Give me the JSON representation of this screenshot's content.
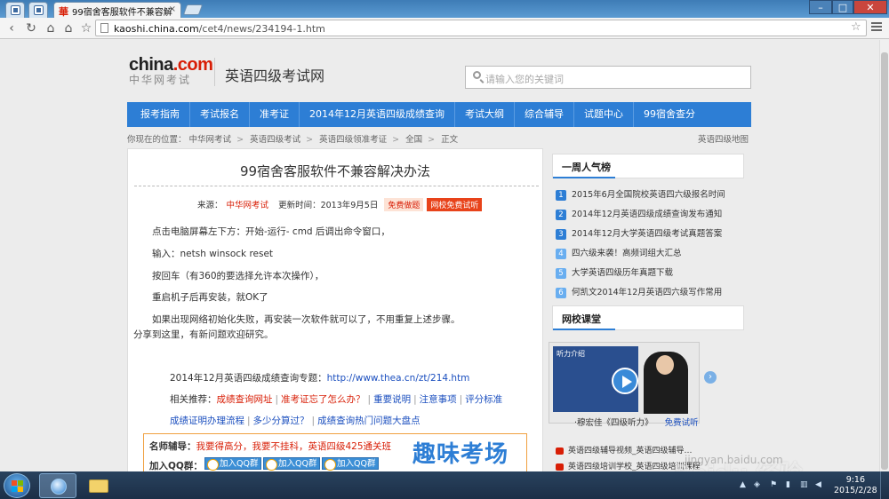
{
  "browser": {
    "tab_active_title": "99宿舍客服软件不兼容解",
    "tab_close": "×",
    "url_host": "kaoshi.china.com",
    "url_path": "/cet4/news/234194-1.htm",
    "win_minimize": "–",
    "win_maximize": "□",
    "win_close": "✕"
  },
  "header": {
    "logo_main": "china",
    "logo_dot": ".com",
    "logo_sub": "中华网考试",
    "site_title": "英语四级考试网",
    "search_placeholder": "请输入您的关键词"
  },
  "nav": [
    "报考指南",
    "考试报名",
    "准考证",
    "2014年12月英语四级成绩查询",
    "考试大纲",
    "综合辅导",
    "试题中心",
    "99宿舍查分"
  ],
  "breadcrumb": {
    "prefix": "你现在的位置：",
    "items": [
      "中华网考试",
      "英语四级考试",
      "英语四级领准考证",
      "全国",
      "正文"
    ],
    "sep": ">",
    "sitemap": "英语四级地图"
  },
  "article": {
    "title": "99宿舍客服软件不兼容解决办法",
    "source_label": "来源：",
    "source": "中华网考试",
    "updated_label": "更新时间：",
    "updated": "2013年9月5日",
    "tag1": "免费做题",
    "tag2": "网校免费试听",
    "paragraphs": [
      "点击电脑屏幕左下方：开始-运行- cmd 后调出命令窗口，",
      "输入：netsh winsock reset",
      "按回车（有360的要选择允许本次操作），",
      "重启机子后再安装，就OK了",
      "如果出现网络初始化失败，再安装一次软件就可以了，不用重复上述步骤。",
      "分享到这里，有新问题欢迎研究。"
    ],
    "topic_label": "2014年12月英语四级成绩查询专题：",
    "topic_link": "http://www.thea.cn/zt/214.htm",
    "related_label": "相关推荐：",
    "related": [
      "成绩查询网址",
      "准考证忘了怎么办？",
      "重要说明",
      "注意事项",
      "评分标准"
    ],
    "related2": [
      "成绩证明办理流程",
      "多少分算过？",
      "成绩查询热门问题大盘点"
    ]
  },
  "promo": {
    "teacher_label": "名师辅导：",
    "teacher_text": "我要得高分，我要不挂科，英语四级425通关班",
    "qq_label": "加入QQ群：",
    "qq_buttons": [
      "加入QQ群",
      "加入QQ群",
      "加入QQ群"
    ],
    "banner": "趣味考场"
  },
  "sidebar": {
    "weekly_title": "一周人气榜",
    "weekly": [
      {
        "n": "1",
        "text": "2015年6月全国院校英语四六级报名时间"
      },
      {
        "n": "2",
        "text": "2014年12月英语四级成绩查询发布通知"
      },
      {
        "n": "3",
        "text": "2014年12月大学英语四级考试真题答案"
      },
      {
        "n": "4",
        "text": "四六级来袭！高频词组大汇总"
      },
      {
        "n": "5",
        "text": "大学英语四级历年真题下载"
      },
      {
        "n": "6",
        "text": "何凯文2014年12月英语四六级写作常用"
      }
    ],
    "class_title": "网校课堂",
    "video_panel_head": "听力介绍",
    "video_caption": "·穆宏佳《四级听力》",
    "video_free": "免费试听",
    "arrow_left": "‹",
    "arrow_right": "›",
    "links": [
      "英语四级辅导视频_英语四级辅导…",
      "英语四级培训学校_英语四级培训课程"
    ]
  },
  "taskbar": {
    "time": "9:16",
    "date": "2015/2/28"
  },
  "watermark": {
    "text": "Baidu 经验",
    "url": "jingyan.baidu.com"
  },
  "colors": {
    "nav_blue": "#2d7ed5",
    "brand_red": "#d81e06",
    "link_blue": "#1b4fbf"
  }
}
